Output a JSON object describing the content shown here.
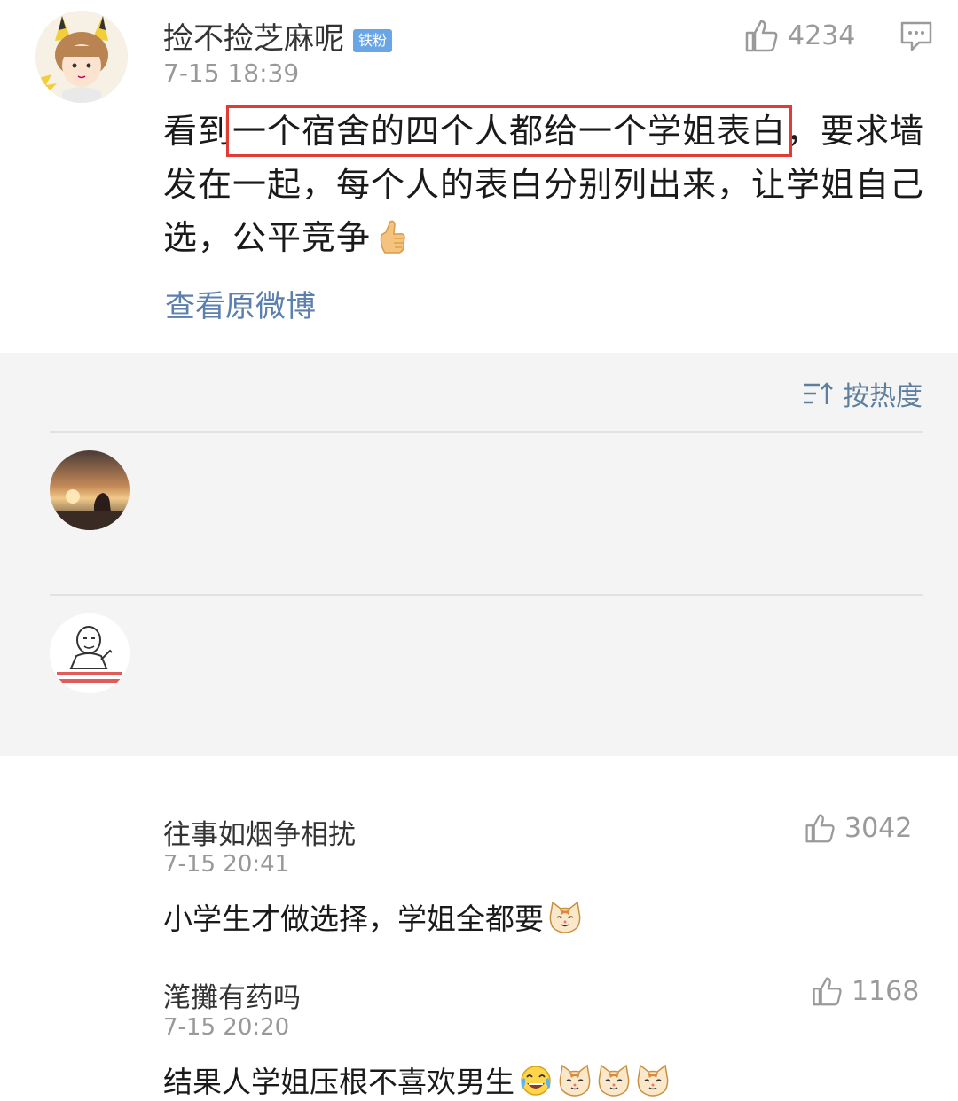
{
  "post": {
    "username": "捡不捡芝麻呢",
    "badge": "铁粉",
    "time": "7-15 18:39",
    "likes": "4234",
    "text_before": "看到",
    "text_highlight": "一个宿舍的四个人都给一个学姐表白",
    "text_after": "，要求墙发在一起，每个人的表白分别列出来，让学姐自己选，公平竞争",
    "text_emoji": "thumbs-up-emoji",
    "view_original": "查看原微博",
    "highlight_color": "#e23b35"
  },
  "sort": {
    "label": "按热度"
  },
  "comments": [
    {
      "username": "往事如烟争相扰",
      "time": "7-15 20:41",
      "likes": "3042",
      "text": "小学生才做选择，学姐全都要",
      "emojis": [
        "cat-face-emoji"
      ]
    },
    {
      "username": "滗攤有药吗",
      "time": "7-15 20:20",
      "likes": "1168",
      "text": "结果人学姐压根不喜欢男生",
      "emojis": [
        "laughing-tears-emoji",
        "cat-face-emoji",
        "cat-face-emoji",
        "cat-face-emoji"
      ]
    }
  ],
  "colors": {
    "link": "#5b7fae",
    "sort_text": "#5d7f9f",
    "meta": "#999999",
    "comments_bg": "#f4f4f4"
  }
}
